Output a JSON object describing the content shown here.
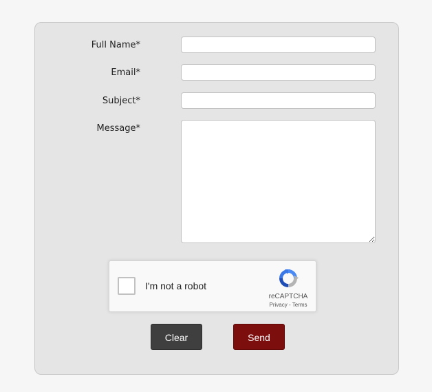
{
  "form": {
    "fields": [
      {
        "label": "Full Name*",
        "value": "",
        "placeholder": ""
      },
      {
        "label": "Email*",
        "value": "",
        "placeholder": ""
      },
      {
        "label": "Subject*",
        "value": "",
        "placeholder": ""
      },
      {
        "label": "Message*",
        "value": "",
        "placeholder": ""
      }
    ],
    "captcha": {
      "checkbox_label": "I'm not a robot",
      "brand": "reCAPTCHA",
      "privacy": "Privacy",
      "separator": " - ",
      "terms": "Terms",
      "logo_icon": "recaptcha-icon"
    },
    "buttons": {
      "clear_label": "Clear",
      "send_label": "Send"
    }
  },
  "colors": {
    "page_background": "#f6f6f6",
    "panel_background": "#e5e5e5",
    "clear_button": "#3f3f3f",
    "send_button": "#7d0e0e"
  }
}
